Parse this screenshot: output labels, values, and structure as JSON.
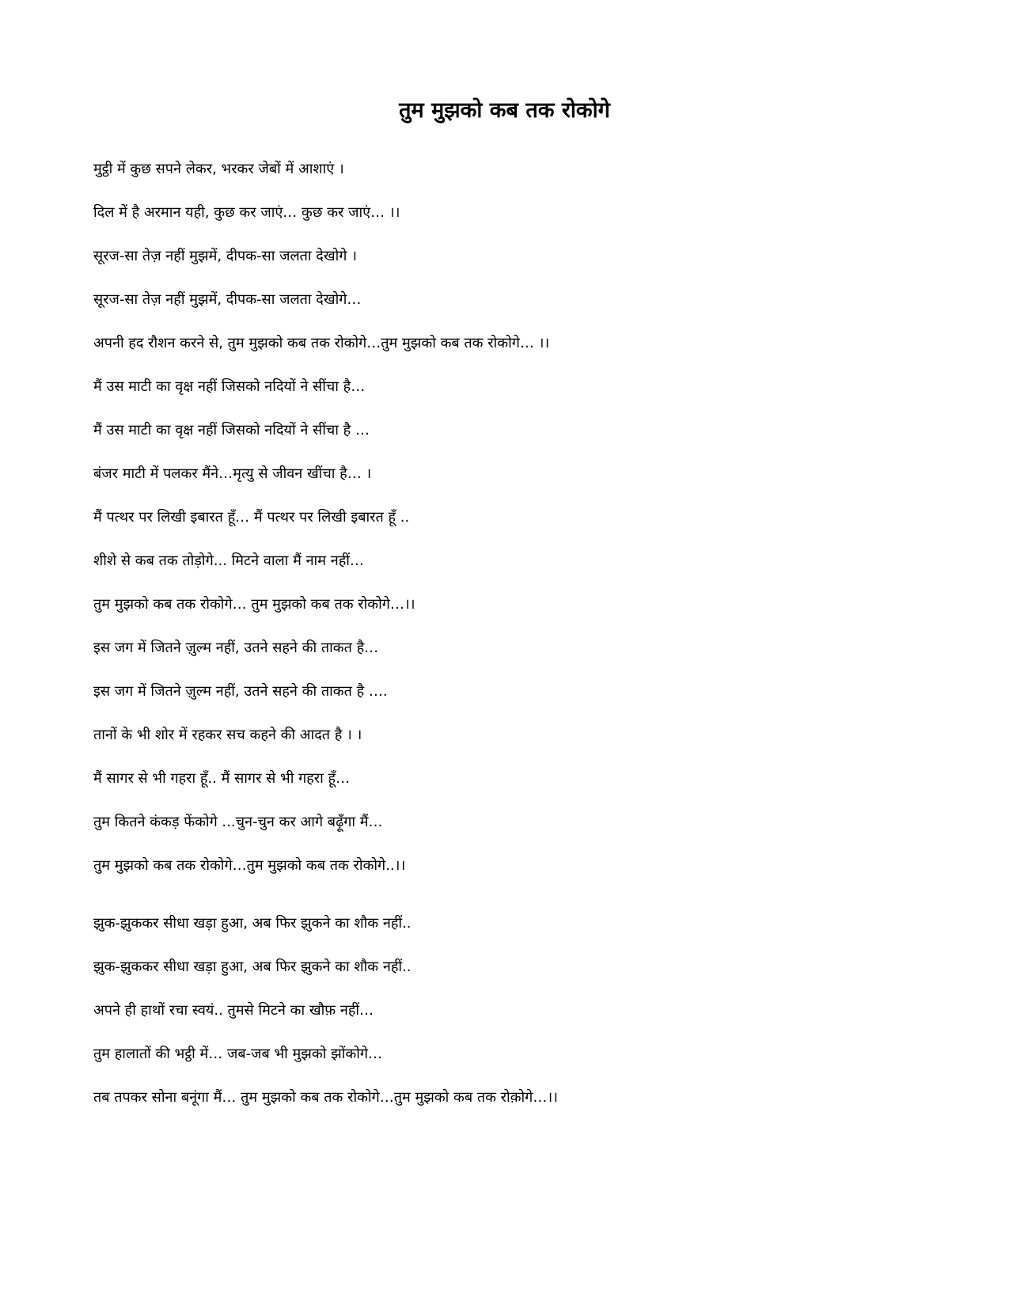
{
  "document": {
    "title": "तुम मुझको कब तक रोकोगे",
    "stanzas": [
      {
        "lines": [
          "मुट्ठी में कुछ सपने लेकर, भरकर जेबों में आशाएं ।",
          "दिल में है अरमान यही, कुछ कर जाएं… कुछ कर जाएं… ।।",
          "सूरज-सा तेज़ नहीं मुझमें, दीपक-सा जलता देखोगे ।",
          "सूरज-सा तेज़ नहीं मुझमें, दीपक-सा जलता देखोगे…",
          "अपनी हद रौशन करने से, तुम मुझको कब तक रोकोगे…तुम मुझको कब तक रोकोगे… ।।"
        ]
      },
      {
        "lines": [
          "मैं उस माटी का वृक्ष नहीं जिसको नदियों ने सींचा है…",
          "मैं उस माटी का वृक्ष नहीं जिसको नदियों ने सींचा है …",
          "बंजर माटी में पलकर मैंने…मृत्यु से जीवन खींचा है… ।",
          "मैं पत्थर पर लिखी इबारत हूँ… मैं पत्थर पर लिखी इबारत हूँ ..",
          "शीशे से कब तक तोड़ोगे... मिटने वाला मैं नाम नहीं…",
          "तुम मुझको कब तक रोकोगे… तुम मुझको कब तक रोकोगे…।।"
        ]
      },
      {
        "lines": [
          "इस जग में जितने ज़ुल्म नहीं, उतने सहने की ताकत है…",
          "इस जग में जितने ज़ुल्म नहीं, उतने सहने की ताकत है ….",
          "तानों  के भी शोर में रहकर सच कहने की आदत है । ।",
          "मैं सागर से भी गहरा हूँ.. मैं सागर से भी गहरा हूँ…",
          "तुम कितने कंकड़ फेंकोगे ...चुन-चुन कर आगे बढ़ूँगा मैं…",
          "तुम मुझको कब तक रोकोगे…तुम मुझको कब तक रोकोगे..।।"
        ]
      },
      {
        "lines": [
          "झुक-झुककर सीधा खड़ा हुआ, अब फिर झुकने का शौक नहीं..",
          "झुक-झुककर सीधा खड़ा हुआ, अब फिर झुकने का शौक नहीं..",
          "अपने ही हाथों रचा स्वयं.. तुमसे मिटने का खौफ़ नहीं…",
          "तुम हालातों की भट्ठी में… जब-जब भी मुझको झोंकोगे…",
          "तब तपकर सोना बनूंगा मैं… तुम मुझको कब तक रोकोगे…तुम मुझको कब तक रोक़ोगे…।।"
        ]
      }
    ]
  }
}
